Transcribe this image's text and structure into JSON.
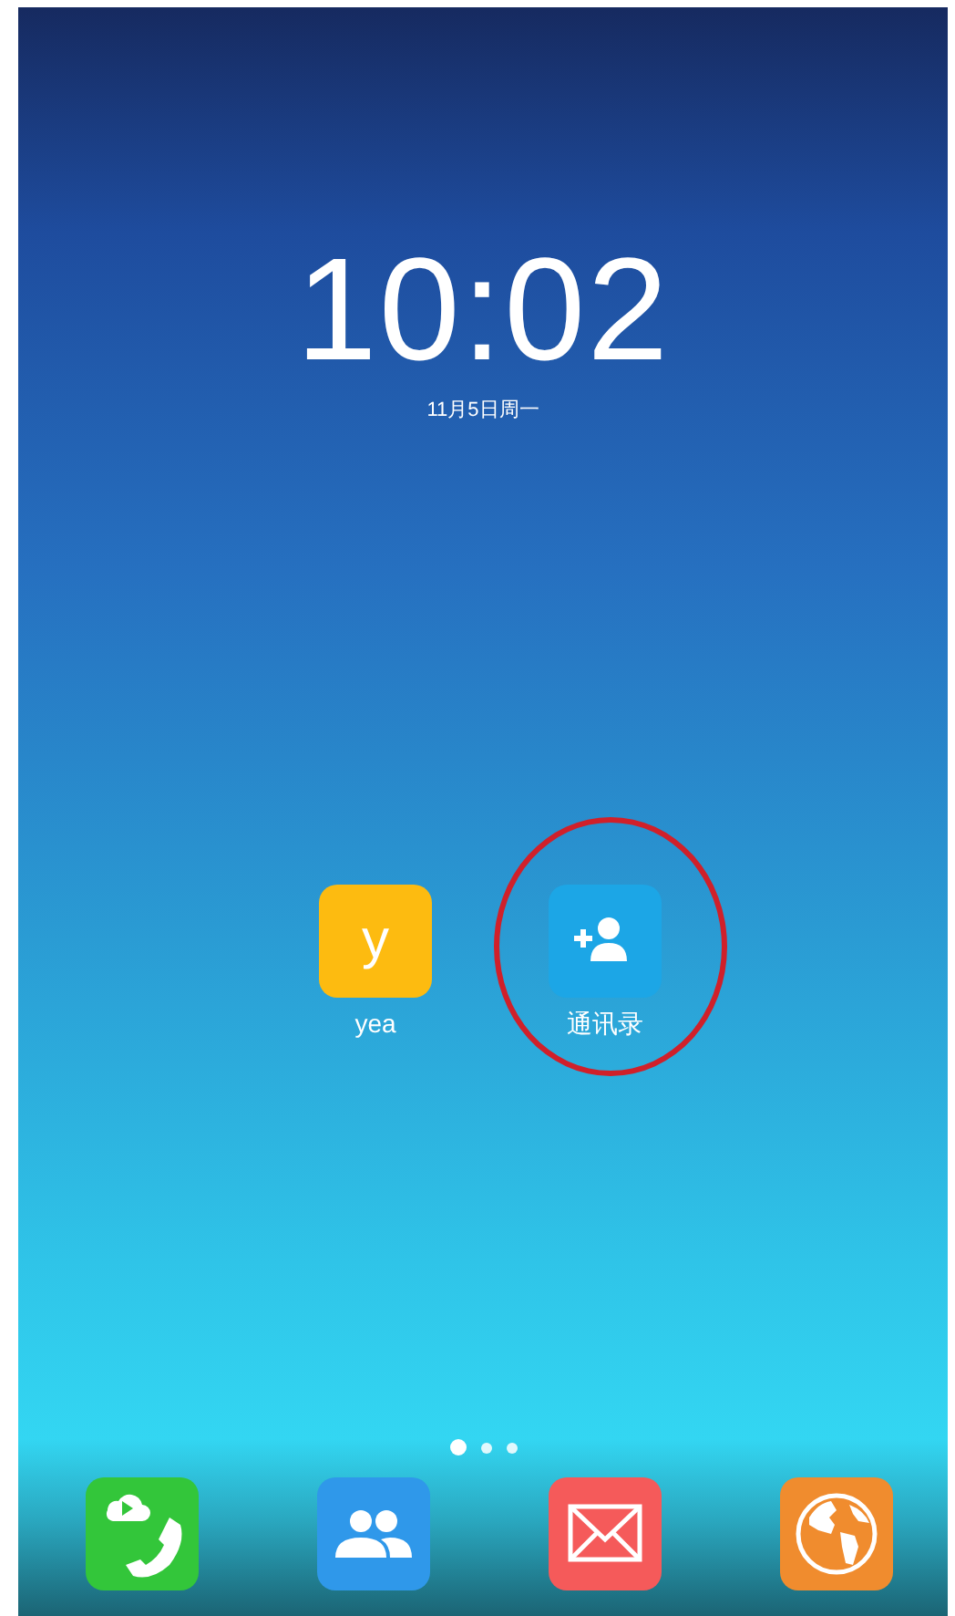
{
  "clock": {
    "time": "10:02",
    "date": "11月5日周一"
  },
  "apps": [
    {
      "kind": "letter",
      "glyph": "y",
      "label": "yea"
    },
    {
      "kind": "add-contact",
      "label": "通讯录",
      "highlighted": true
    }
  ],
  "page_dots": [
    {
      "selected": true
    },
    {
      "selected": false
    },
    {
      "selected": false
    }
  ],
  "dock": [
    {
      "kind": "phone"
    },
    {
      "kind": "people"
    },
    {
      "kind": "mail"
    },
    {
      "kind": "globe"
    }
  ]
}
